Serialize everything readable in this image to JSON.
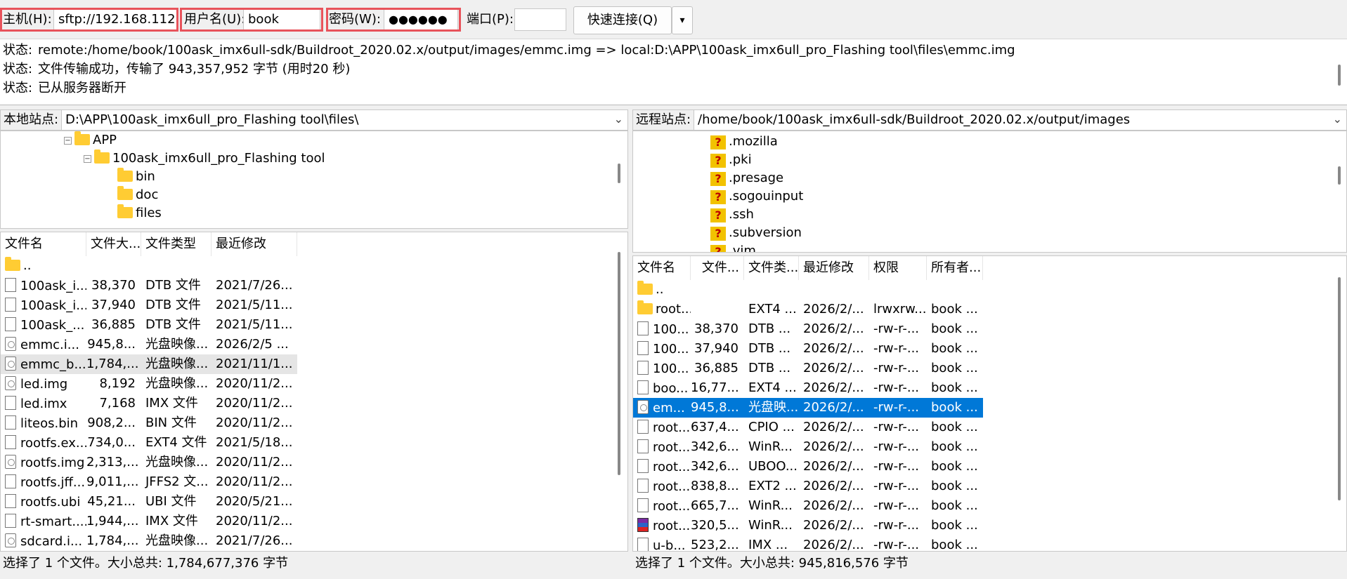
{
  "quickconnect": {
    "host_label": "主机(H):",
    "host_value": "sftp://192.168.112.",
    "user_label": "用户名(U):",
    "user_value": "book",
    "password_label": "密码(W):",
    "password_value": "●●●●●●",
    "port_label": "端口(P):",
    "port_value": "",
    "connect_button": "快速连接(Q)",
    "dropdown_arrow": "▾",
    "highlight_color": "#e8535b"
  },
  "log": [
    {
      "key": "状态:",
      "text": "remote:/home/book/100ask_imx6ull-sdk/Buildroot_2020.02.x/output/images/emmc.img => local:D:\\APP\\100ask_imx6ull_pro_Flashing tool\\files\\emmc.img"
    },
    {
      "key": "状态:",
      "text": "文件传输成功，传输了 943,357,952 字节 (用时20 秒)"
    },
    {
      "key": "状态:",
      "text": "已从服务器断开"
    }
  ],
  "local": {
    "site_label": "本地站点:",
    "site_path": "D:\\APP\\100ask_imx6ull_pro_Flashing tool\\files\\",
    "tree": [
      {
        "label": "APP",
        "expander": "−"
      },
      {
        "label": "100ask_imx6ull_pro_Flashing tool",
        "expander": "−"
      },
      {
        "label": "bin"
      },
      {
        "label": "doc"
      },
      {
        "label": "files"
      }
    ],
    "columns": [
      "文件名",
      "文件大...",
      "文件类型",
      "最近修改"
    ],
    "files": [
      {
        "name": "..",
        "size": "",
        "type": "",
        "modified": "",
        "icon": "folder"
      },
      {
        "name": "100ask_i...",
        "size": "38,370",
        "type": "DTB 文件",
        "modified": "2021/7/26...",
        "icon": "file"
      },
      {
        "name": "100ask_i...",
        "size": "37,940",
        "type": "DTB 文件",
        "modified": "2021/5/11...",
        "icon": "file"
      },
      {
        "name": "100ask_...",
        "size": "36,885",
        "type": "DTB 文件",
        "modified": "2021/5/11...",
        "icon": "file"
      },
      {
        "name": "emmc.i...",
        "size": "945,8...",
        "type": "光盘映像...",
        "modified": "2026/2/5 ...",
        "icon": "disc"
      },
      {
        "name": "emmc_b...",
        "size": "1,784,...",
        "type": "光盘映像...",
        "modified": "2021/11/1...",
        "icon": "disc"
      },
      {
        "name": "led.img",
        "size": "8,192",
        "type": "光盘映像...",
        "modified": "2020/11/2...",
        "icon": "disc"
      },
      {
        "name": "led.imx",
        "size": "7,168",
        "type": "IMX 文件",
        "modified": "2020/11/2...",
        "icon": "file"
      },
      {
        "name": "liteos.bin",
        "size": "908,2...",
        "type": "BIN 文件",
        "modified": "2020/11/2...",
        "icon": "file"
      },
      {
        "name": "rootfs.ex...",
        "size": "734,0...",
        "type": "EXT4 文件",
        "modified": "2021/5/18...",
        "icon": "file"
      },
      {
        "name": "rootfs.img",
        "size": "2,313,...",
        "type": "光盘映像...",
        "modified": "2020/11/2...",
        "icon": "disc"
      },
      {
        "name": "rootfs.jff...",
        "size": "9,011,...",
        "type": "JFFS2 文...",
        "modified": "2020/11/2...",
        "icon": "file"
      },
      {
        "name": "rootfs.ubi",
        "size": "45,21...",
        "type": "UBI 文件",
        "modified": "2020/5/21...",
        "icon": "file"
      },
      {
        "name": "rt-smart....",
        "size": "1,944,...",
        "type": "IMX 文件",
        "modified": "2020/11/2...",
        "icon": "file"
      },
      {
        "name": "sdcard.i...",
        "size": "1,784,...",
        "type": "光盘映像...",
        "modified": "2021/7/26...",
        "icon": "disc"
      }
    ],
    "status": "选择了 1 个文件。大小总共: 1,784,677,376 字节"
  },
  "remote": {
    "site_label": "远程站点:",
    "site_path": "/home/book/100ask_imx6ull-sdk/Buildroot_2020.02.x/output/images",
    "tree": [
      {
        "label": ".mozilla"
      },
      {
        "label": ".pki"
      },
      {
        "label": ".presage"
      },
      {
        "label": ".sogouinput"
      },
      {
        "label": ".ssh"
      },
      {
        "label": ".subversion"
      },
      {
        "label": ".vim"
      }
    ],
    "unknown_icon": "?",
    "columns": [
      "文件名",
      "文件...",
      "文件类...",
      "最近修改",
      "权限",
      "所有者..."
    ],
    "files": [
      {
        "name": "..",
        "size": "",
        "type": "",
        "modified": "",
        "perm": "",
        "owner": "",
        "icon": "folder"
      },
      {
        "name": "root...",
        "size": "",
        "type": "EXT4 ...",
        "modified": "2026/2/...",
        "perm": "lrwxrw...",
        "owner": "book ...",
        "icon": "folder"
      },
      {
        "name": "100...",
        "size": "38,370",
        "type": "DTB ...",
        "modified": "2026/2/...",
        "perm": "-rw-r-...",
        "owner": "book ...",
        "icon": "file"
      },
      {
        "name": "100...",
        "size": "37,940",
        "type": "DTB ...",
        "modified": "2026/2/...",
        "perm": "-rw-r-...",
        "owner": "book ...",
        "icon": "file"
      },
      {
        "name": "100...",
        "size": "36,885",
        "type": "DTB ...",
        "modified": "2026/2/...",
        "perm": "-rw-r-...",
        "owner": "book ...",
        "icon": "file"
      },
      {
        "name": "boo...",
        "size": "16,77...",
        "type": "EXT4 ...",
        "modified": "2026/2/...",
        "perm": "-rw-r-...",
        "owner": "book ...",
        "icon": "file"
      },
      {
        "name": "em...",
        "size": "945,8...",
        "type": "光盘映...",
        "modified": "2026/2/...",
        "perm": "-rw-r-...",
        "owner": "book ...",
        "icon": "disc"
      },
      {
        "name": "root...",
        "size": "637,4...",
        "type": "CPIO ...",
        "modified": "2026/2/...",
        "perm": "-rw-r-...",
        "owner": "book ...",
        "icon": "file"
      },
      {
        "name": "root...",
        "size": "342,6...",
        "type": "WinR...",
        "modified": "2026/2/...",
        "perm": "-rw-r-...",
        "owner": "book ...",
        "icon": "file"
      },
      {
        "name": "root...",
        "size": "342,6...",
        "type": "UBOO...",
        "modified": "2026/2/...",
        "perm": "-rw-r-...",
        "owner": "book ...",
        "icon": "file"
      },
      {
        "name": "root...",
        "size": "838,8...",
        "type": "EXT2 ...",
        "modified": "2026/2/...",
        "perm": "-rw-r-...",
        "owner": "book ...",
        "icon": "file"
      },
      {
        "name": "root...",
        "size": "665,7...",
        "type": "WinR...",
        "modified": "2026/2/...",
        "perm": "-rw-r-...",
        "owner": "book ...",
        "icon": "file"
      },
      {
        "name": "root...",
        "size": "320,5...",
        "type": "WinR...",
        "modified": "2026/2/...",
        "perm": "-rw-r-...",
        "owner": "book ...",
        "icon": "rar"
      },
      {
        "name": "u-b...",
        "size": "523,2...",
        "type": "IMX ...",
        "modified": "2026/2/...",
        "perm": "-rw-r-...",
        "owner": "book ...",
        "icon": "file"
      }
    ],
    "status": "选择了 1 个文件。大小总共: 945,816,576 字节"
  },
  "selection_color": "#0078d7"
}
